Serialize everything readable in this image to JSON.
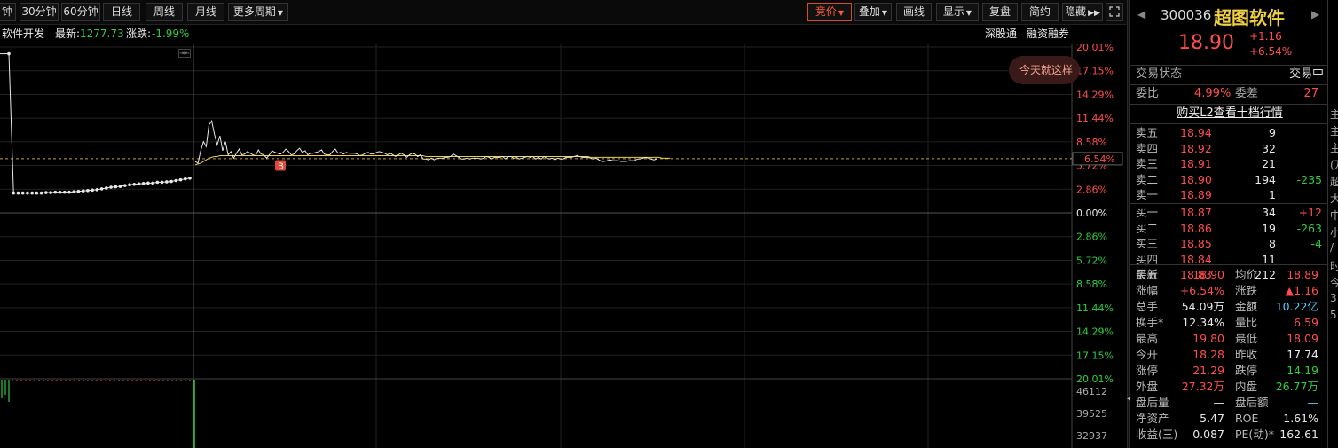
{
  "toolbar": {
    "periods": [
      "钟",
      "30分钟",
      "60分钟",
      "日线",
      "周线",
      "月线",
      "更多周期"
    ],
    "tools": [
      "竞价",
      "叠加",
      "画线",
      "显示",
      "复盘",
      "简约",
      "隐藏"
    ],
    "icons": [
      "dropdown-arrow-icon",
      "double-arrow-icon",
      "fullscreen-icon"
    ]
  },
  "infobar": {
    "sector": "软件开发",
    "latest_label": "最新:",
    "latest_value": "1277.73",
    "change_label": "涨跌:",
    "change_value": "-1.99%",
    "links": [
      "深股通",
      "融资融券"
    ],
    "popup_text": "今天就这样"
  },
  "chart_data": {
    "type": "line",
    "y_pct_labels_up": [
      "20.01%",
      "17.15%",
      "14.29%",
      "11.44%",
      "8.58%",
      "5.72%",
      "2.86%"
    ],
    "zero_label": "0.00%",
    "y_pct_labels_down": [
      "2.86%",
      "5.72%",
      "8.58%",
      "11.44%",
      "14.29%",
      "17.15%",
      "20.01%"
    ],
    "current_pct_label": "6.54%",
    "volume_labels": [
      "46112",
      "39525",
      "32937"
    ],
    "buy_marker": "B",
    "ylim_pct": [
      -20.01,
      20.01
    ],
    "price_pct": [
      6.2,
      6.0,
      7.5,
      8.6,
      8.0,
      10.6,
      11.1,
      9.5,
      8.2,
      9.3,
      7.5,
      8.6,
      7.0,
      7.4,
      6.6,
      7.2,
      7.7,
      7.0,
      7.1,
      7.4,
      7.2,
      7.0,
      6.9,
      7.6,
      7.1,
      7.0,
      6.6,
      7.0,
      7.5,
      7.3,
      7.2,
      7.1,
      7.3,
      7.7,
      7.4,
      7.0,
      7.1,
      7.5,
      7.8,
      7.3,
      7.5,
      7.0,
      7.2,
      7.2,
      7.3,
      7.4,
      7.6,
      7.1,
      7.0,
      7.0,
      7.4,
      7.7,
      7.2,
      7.3,
      7.1,
      7.3,
      7.2,
      7.2,
      7.2,
      7.1,
      6.9,
      7.0,
      7.2,
      7.3,
      7.1,
      7.1,
      7.3,
      7.4,
      7.3,
      7.2,
      7.0,
      7.2,
      7.0,
      6.8,
      7.0,
      7.2,
      7.0,
      6.7,
      7.0,
      7.2,
      7.1,
      6.8,
      7.0,
      6.5,
      6.5,
      6.4,
      6.6,
      6.4,
      6.6,
      6.6,
      6.6,
      6.7,
      6.7,
      6.8,
      7.1,
      6.9,
      6.7,
      6.5,
      6.5,
      6.6,
      6.5,
      6.6,
      6.6,
      6.6,
      6.5,
      6.6,
      6.8,
      6.7,
      6.5,
      6.7,
      6.7,
      6.7,
      6.8,
      6.5,
      6.8,
      6.8,
      6.6,
      6.7,
      6.5,
      6.6,
      6.7,
      6.8,
      6.7,
      6.8,
      6.5,
      6.7,
      6.5,
      6.8,
      6.6,
      6.5,
      6.6,
      6.4,
      6.6,
      6.5,
      6.5,
      6.7,
      6.7,
      6.7,
      6.8,
      6.9,
      6.8,
      6.7,
      6.7,
      6.7,
      6.6,
      6.5,
      6.6,
      6.4,
      6.2,
      6.2,
      6.3,
      6.4,
      6.3,
      6.3,
      6.3,
      6.2,
      6.2,
      6.2,
      6.3,
      6.3,
      6.3,
      6.5,
      6.5,
      6.6,
      6.7,
      6.6,
      6.5,
      6.4,
      6.5
    ],
    "avg_pct": [
      5.8,
      5.9,
      6.0,
      6.2,
      6.4,
      6.6,
      6.7,
      6.8,
      6.8,
      6.9,
      6.9,
      6.9,
      6.9,
      6.9,
      6.9,
      6.9,
      6.9,
      6.9,
      6.9,
      6.9,
      6.9,
      6.9,
      6.9,
      6.9,
      6.9,
      6.9,
      6.9,
      6.9,
      6.9,
      6.9,
      6.9,
      6.9,
      6.9,
      6.9,
      6.9,
      6.9,
      6.9,
      6.9,
      6.9,
      6.9,
      6.9,
      6.9,
      6.9,
      6.9,
      6.9,
      6.9,
      6.9,
      6.9,
      6.9,
      6.9,
      6.9,
      6.9,
      6.9,
      6.9,
      6.9,
      6.9,
      6.9,
      6.9,
      6.9,
      6.9,
      6.9,
      6.9,
      6.9,
      6.9,
      6.9,
      6.9,
      6.9,
      6.9,
      6.9,
      6.9,
      6.9,
      6.9,
      6.9,
      6.9,
      6.9,
      6.9,
      6.9,
      6.9,
      6.9,
      6.9,
      6.9,
      6.9,
      6.9,
      6.9,
      6.8,
      6.8,
      6.8,
      6.8,
      6.8,
      6.8,
      6.8,
      6.8,
      6.8,
      6.8,
      6.8,
      6.8,
      6.8,
      6.8,
      6.8,
      6.8,
      6.8,
      6.8,
      6.8,
      6.8,
      6.8,
      6.8,
      6.8,
      6.8,
      6.8,
      6.8,
      6.8,
      6.8,
      6.8,
      6.8,
      6.8,
      6.8,
      6.8,
      6.8,
      6.8,
      6.8,
      6.8,
      6.8,
      6.8,
      6.8,
      6.8,
      6.8,
      6.8,
      6.8,
      6.8,
      6.8,
      6.8,
      6.8,
      6.8,
      6.8,
      6.8,
      6.8,
      6.8,
      6.8,
      6.8,
      6.8,
      6.8,
      6.8,
      6.8,
      6.8,
      6.7,
      6.7,
      6.7,
      6.7,
      6.7,
      6.7,
      6.7,
      6.7,
      6.7,
      6.7,
      6.7,
      6.7,
      6.7,
      6.7,
      6.7,
      6.7,
      6.7,
      6.7,
      6.7,
      6.7,
      6.7,
      6.7,
      6.7,
      6.7,
      6.7,
      6.7,
      6.6,
      6.6,
      6.6,
      6.6
    ],
    "auction_pct": [
      19.2,
      2.4,
      2.4,
      2.4,
      2.4,
      2.4,
      2.4,
      2.4,
      2.45,
      2.45,
      2.5,
      2.5,
      2.5,
      2.5,
      2.55,
      2.6,
      2.65,
      2.7,
      2.75,
      2.8,
      2.9,
      3.0,
      3.1,
      3.15,
      3.2,
      3.3,
      3.4,
      3.45,
      3.5,
      3.55,
      3.6,
      3.6,
      3.7,
      3.7,
      3.75,
      3.8,
      3.9,
      4.0,
      4.1,
      4.2
    ]
  },
  "panel": {
    "code": "300036",
    "name": "超图软件",
    "price": "18.90",
    "change": "+1.16",
    "change_pct": "+6.54%",
    "status_label": "交易状态",
    "status_value": "交易中",
    "weibi_label": "委比",
    "weibi_value": "4.99%",
    "weicha_label": "委差",
    "weicha_value": "27",
    "l2_link": "购买L2查看十档行情",
    "asks": [
      {
        "label": "卖五",
        "price": "18.94",
        "vol": "9",
        "delta": ""
      },
      {
        "label": "卖四",
        "price": "18.92",
        "vol": "32",
        "delta": ""
      },
      {
        "label": "卖三",
        "price": "18.91",
        "vol": "21",
        "delta": ""
      },
      {
        "label": "卖二",
        "price": "18.90",
        "vol": "194",
        "delta": "-235"
      },
      {
        "label": "卖一",
        "price": "18.89",
        "vol": "1",
        "delta": ""
      }
    ],
    "bids": [
      {
        "label": "买一",
        "price": "18.87",
        "vol": "34",
        "delta": "+12"
      },
      {
        "label": "买二",
        "price": "18.86",
        "vol": "19",
        "delta": "-263"
      },
      {
        "label": "买三",
        "price": "18.85",
        "vol": "8",
        "delta": "-4"
      },
      {
        "label": "买四",
        "price": "18.84",
        "vol": "11",
        "delta": ""
      },
      {
        "label": "买五",
        "price": "18.83",
        "vol": "212",
        "delta": ""
      }
    ],
    "stats": [
      {
        "l1": "最新",
        "v1": "18.90",
        "c1": "r",
        "l2": "均价",
        "v2": "18.89",
        "c2": "r"
      },
      {
        "l1": "涨幅",
        "v1": "+6.54%",
        "c1": "r",
        "l2": "涨跌",
        "v2": "▲1.16",
        "c2": "r"
      },
      {
        "l1": "总手",
        "v1": "54.09万",
        "c1": "w",
        "l2": "金额",
        "v2": "10.22亿",
        "c2": "c"
      },
      {
        "l1": "换手*",
        "v1": "12.34%",
        "c1": "w",
        "l2": "量比",
        "v2": "6.59",
        "c2": "r"
      },
      {
        "l1": "最高",
        "v1": "19.80",
        "c1": "r",
        "l2": "最低",
        "v2": "18.09",
        "c2": "r"
      },
      {
        "l1": "今开",
        "v1": "18.28",
        "c1": "r",
        "l2": "昨收",
        "v2": "17.74",
        "c2": "w"
      },
      {
        "l1": "涨停",
        "v1": "21.29",
        "c1": "r",
        "l2": "跌停",
        "v2": "14.19",
        "c2": "g"
      },
      {
        "l1": "外盘",
        "v1": "27.32万",
        "c1": "r",
        "l2": "内盘",
        "v2": "26.77万",
        "c2": "g"
      },
      {
        "l1": "盘后量",
        "v1": "—",
        "c1": "w",
        "l2": "盘后额",
        "v2": "—",
        "c2": "c"
      },
      {
        "l1": "净资产",
        "v1": "5.47",
        "c1": "w",
        "l2": "ROE",
        "v2": "1.61%",
        "c2": "w"
      },
      {
        "l1": "收益(三)",
        "v1": "0.087",
        "c1": "w",
        "l2": "PE(动)*",
        "v2": "162.61",
        "c2": "w"
      }
    ],
    "edge_chars": [
      "主",
      "主",
      "主",
      "(万",
      "超",
      "大",
      "中",
      "小",
      "/",
      "时",
      "今",
      "3",
      "5"
    ]
  },
  "colors": {
    "up": "#ff4d4d",
    "down": "#2ecc40",
    "price_line": "#e8e8e8",
    "avg_line": "#f0d040",
    "grid": "#2a2a2a",
    "accent": "#d84a2a"
  }
}
